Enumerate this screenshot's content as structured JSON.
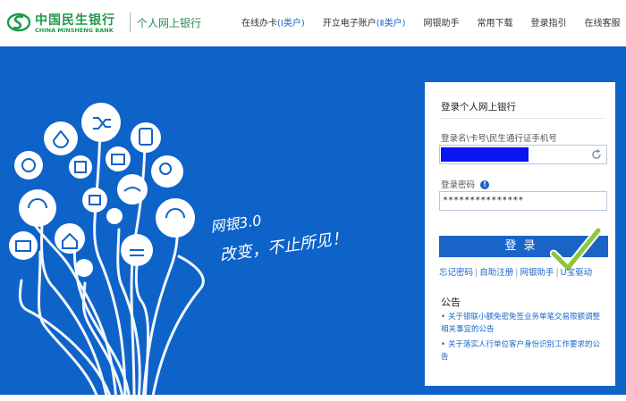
{
  "brand": {
    "name_cn": "中国民生银行",
    "name_en": "CHINA MINSHENG BANK",
    "product": "个人网上银行"
  },
  "nav": {
    "items": [
      {
        "label": "在线办卡",
        "suffix": "(Ⅰ类户)"
      },
      {
        "label": "开立电子账户",
        "suffix": "(Ⅱ类户)"
      },
      {
        "label": "网银助手",
        "suffix": ""
      },
      {
        "label": "常用下载",
        "suffix": ""
      },
      {
        "label": "登录指引",
        "suffix": ""
      },
      {
        "label": "在线客服",
        "suffix": ""
      }
    ]
  },
  "banner": {
    "slogan_line1": "网银3.0",
    "slogan_line2": "改变，不止所见！"
  },
  "login": {
    "title": "登录个人网上银行",
    "username_label": "登录名\\卡号\\民生通行证手机号",
    "password_label": "登录密码",
    "password_value": "***************",
    "submit_label": "登录",
    "links": [
      "忘记密码",
      "自助注册",
      "网银助手",
      "U宝驱动"
    ]
  },
  "notices": {
    "title": "公告",
    "items": [
      "关于银联小额免密免签业务单笔交易限额调整相关事宜的公告",
      "关于落实人行单位客户身份识别工作要求的公告"
    ]
  },
  "colors": {
    "brand_green": "#1e9a4b",
    "banner_blue": "#0e63c9",
    "accent_blue": "#1a64c8"
  }
}
